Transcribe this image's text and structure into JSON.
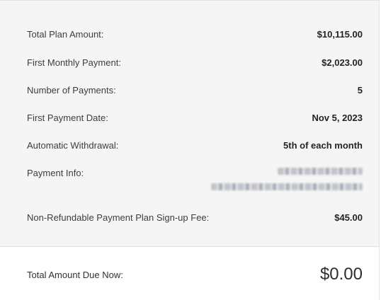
{
  "summary": {
    "rows": [
      {
        "label": "Total Plan Amount:",
        "value": "$10,115.00"
      },
      {
        "label": "First Monthly Payment:",
        "value": "$2,023.00"
      },
      {
        "label": "Number of Payments:",
        "value": "5"
      },
      {
        "label": "First Payment Date:",
        "value": "Nov 5, 2023"
      },
      {
        "label": "Automatic Withdrawal:",
        "value": "5th of each month"
      },
      {
        "label": "Payment Info:"
      },
      {
        "label": "Non-Refundable Payment Plan Sign-up Fee:",
        "value": "$45.00"
      }
    ]
  },
  "total_due": {
    "label": "Total Amount Due Now:",
    "value": "$0.00"
  }
}
